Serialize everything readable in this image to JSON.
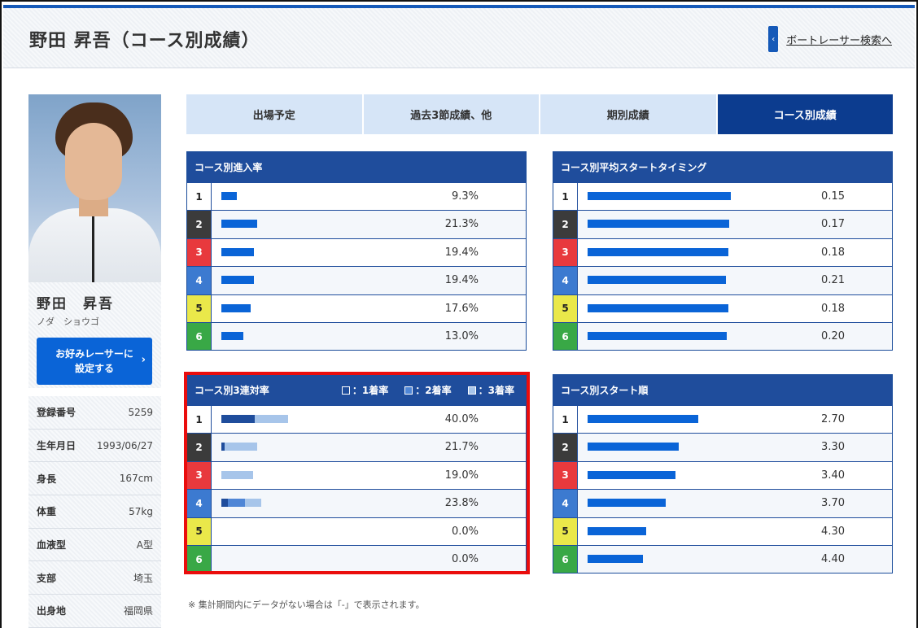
{
  "header": {
    "title": "野田 昇吾（コース別成績）",
    "search_link": "ボートレーサー検索へ",
    "chev": "‹"
  },
  "profile": {
    "name": "野田　昇吾",
    "kana": "ノダ　ショウゴ",
    "fav_button": "お好みレーサーに\n設定する",
    "fav_arrow": "›",
    "info": [
      {
        "k": "登録番号",
        "v": "5259"
      },
      {
        "k": "生年月日",
        "v": "1993/06/27"
      },
      {
        "k": "身長",
        "v": "167cm"
      },
      {
        "k": "体重",
        "v": "57kg"
      },
      {
        "k": "血液型",
        "v": "A型"
      },
      {
        "k": "支部",
        "v": "埼玉"
      },
      {
        "k": "出身地",
        "v": "福岡県"
      }
    ]
  },
  "tabs": [
    "出場予定",
    "過去3節成績、他",
    "期別成績",
    "コース別成績"
  ],
  "lane_colors": {
    "1": {
      "bg": "#ffffff",
      "fg": "#222222"
    },
    "2": {
      "bg": "#3b3b3b",
      "fg": "#ffffff"
    },
    "3": {
      "bg": "#e8393d",
      "fg": "#ffffff"
    },
    "4": {
      "bg": "#3c7ad0",
      "fg": "#ffffff"
    },
    "5": {
      "bg": "#eae84a",
      "fg": "#222222"
    },
    "6": {
      "bg": "#39a846",
      "fg": "#ffffff"
    }
  },
  "panels": {
    "entry": {
      "title": "コース別進入率",
      "rows": [
        {
          "lane": "1",
          "value": 9.3,
          "label": "9.3%"
        },
        {
          "lane": "2",
          "value": 21.3,
          "label": "21.3%"
        },
        {
          "lane": "3",
          "value": 19.4,
          "label": "19.4%"
        },
        {
          "lane": "4",
          "value": 19.4,
          "label": "19.4%"
        },
        {
          "lane": "5",
          "value": 17.6,
          "label": "17.6%"
        },
        {
          "lane": "6",
          "value": 13.0,
          "label": "13.0%"
        }
      ]
    },
    "start_timing": {
      "title": "コース別平均スタートタイミング",
      "rows": [
        {
          "lane": "1",
          "value": 0.15,
          "label": "0.15"
        },
        {
          "lane": "2",
          "value": 0.17,
          "label": "0.17"
        },
        {
          "lane": "3",
          "value": 0.18,
          "label": "0.18"
        },
        {
          "lane": "4",
          "value": 0.21,
          "label": "0.21"
        },
        {
          "lane": "5",
          "value": 0.18,
          "label": "0.18"
        },
        {
          "lane": "6",
          "value": 0.2,
          "label": "0.20"
        }
      ]
    },
    "top3": {
      "title": "コース別3連対率",
      "legend": [
        {
          "label": "：1着率",
          "color": "#1f4d9c"
        },
        {
          "label": "：2着率",
          "color": "#4f86d6"
        },
        {
          "label": "：3着率",
          "color": "#a7c5ea"
        }
      ],
      "rows": [
        {
          "lane": "1",
          "first": 20.0,
          "second": 0,
          "third": 20.0,
          "label": "40.0%"
        },
        {
          "lane": "2",
          "first": 2.0,
          "second": 0,
          "third": 19.7,
          "label": "21.7%"
        },
        {
          "lane": "3",
          "first": 0,
          "second": 0,
          "third": 19.0,
          "label": "19.0%"
        },
        {
          "lane": "4",
          "first": 4.0,
          "second": 10.0,
          "third": 9.8,
          "label": "23.8%"
        },
        {
          "lane": "5",
          "first": 0,
          "second": 0,
          "third": 0,
          "label": "0.0%"
        },
        {
          "lane": "6",
          "first": 0,
          "second": 0,
          "third": 0,
          "label": "0.0%"
        }
      ]
    },
    "start_order": {
      "title": "コース別スタート順",
      "rows": [
        {
          "lane": "1",
          "value": 2.7,
          "label": "2.70"
        },
        {
          "lane": "2",
          "value": 3.3,
          "label": "3.30"
        },
        {
          "lane": "3",
          "value": 3.4,
          "label": "3.40"
        },
        {
          "lane": "4",
          "value": 3.7,
          "label": "3.70"
        },
        {
          "lane": "5",
          "value": 4.3,
          "label": "4.30"
        },
        {
          "lane": "6",
          "value": 4.4,
          "label": "4.40"
        }
      ]
    }
  },
  "note": "※ 集計期間内にデータがない場合は「-」で表示されます。"
}
